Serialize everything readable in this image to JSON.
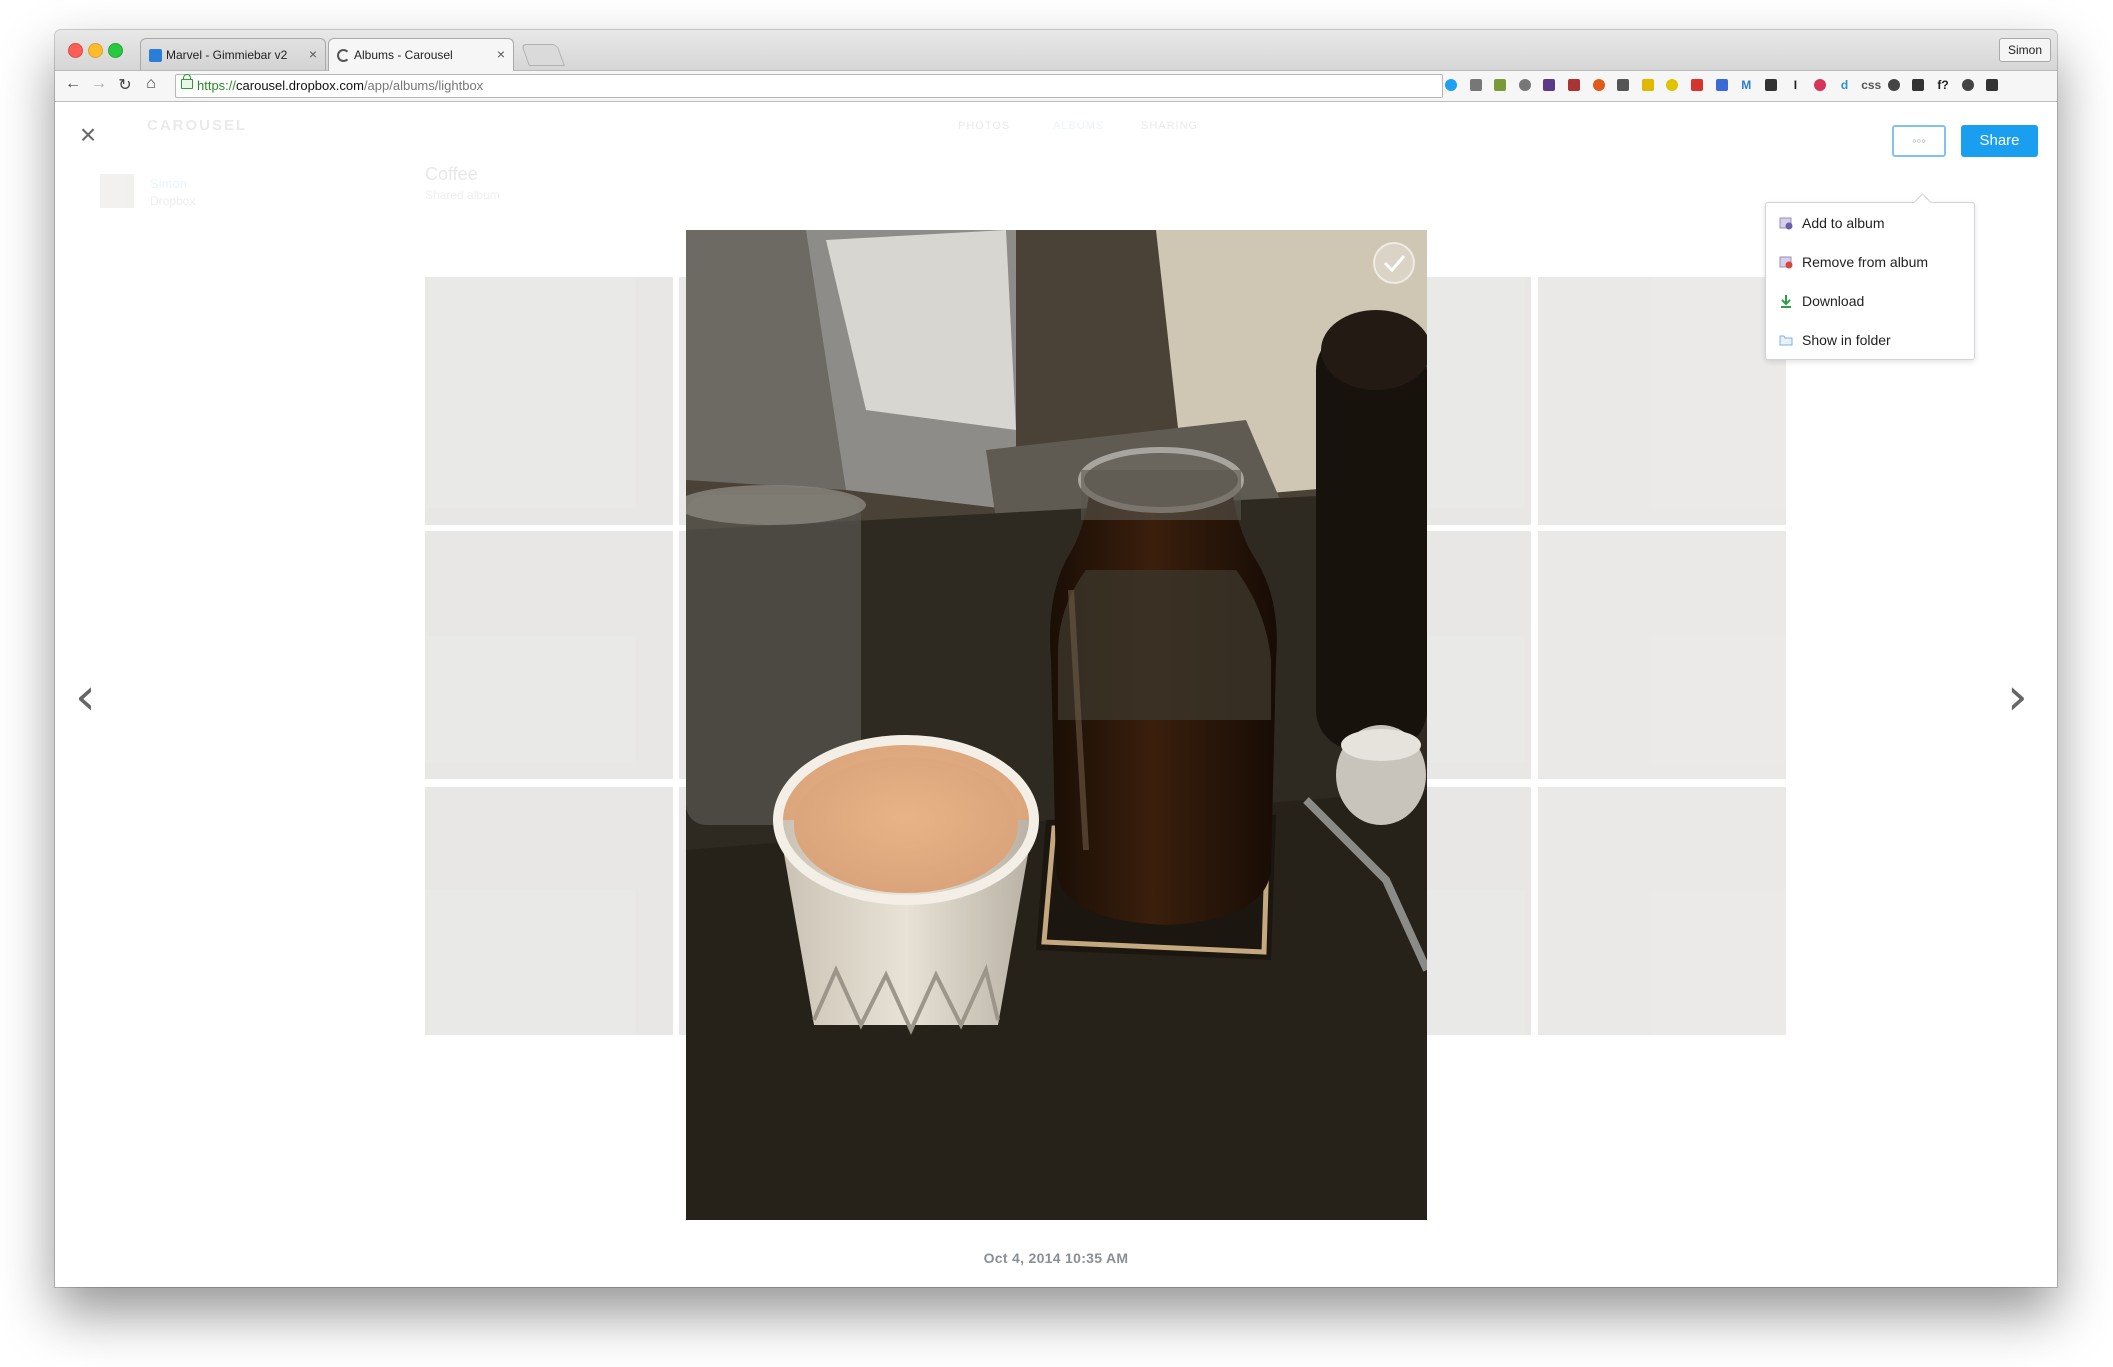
{
  "browser": {
    "tabs": [
      {
        "title": "Marvel - Gimmiebar v2",
        "close": "×"
      },
      {
        "title": "Albums - Carousel",
        "close": "×"
      }
    ],
    "profile": "Simon",
    "url": {
      "scheme": "https://",
      "host": "carousel.dropbox.com",
      "path": "/app/albums/lightbox"
    },
    "extensions": [
      "twitter-icon",
      "reader-icon",
      "feed-icon",
      "star-icon",
      "ext-1",
      "code-icon",
      "fire-icon",
      "mail-icon",
      "note-icon",
      "ext-2",
      "opera-icon",
      "color-icon",
      "m-icon",
      "bars-icon",
      "i-icon",
      "plus-icon",
      "d-icon",
      "css-icon",
      "clock-icon",
      "panel-icon",
      "font-icon",
      "ext-3",
      "menu-icon"
    ],
    "extension_glyphs": {
      "css-icon": "css",
      "font-icon": "f?",
      "i-icon": "I",
      "d-icon": "d",
      "m-icon": "M"
    }
  },
  "app": {
    "logo": "CAROUSEL",
    "nav": [
      "PHOTOS",
      "ALBUMS",
      "SHARING"
    ],
    "sidebar": {
      "name": "Simon",
      "sub": "Dropbox"
    },
    "album": {
      "title": "Coffee",
      "sub": "Shared album"
    }
  },
  "lightbox": {
    "close_glyph": "×",
    "prev_glyph": "‹",
    "next_glyph": "›",
    "more_label": "◦◦◦",
    "share_label": "Share",
    "caption": "Oct 4, 2014 10:35 AM",
    "menu": [
      {
        "label": "Add to album",
        "icon": "add-album-icon"
      },
      {
        "label": "Remove from album",
        "icon": "remove-album-icon"
      },
      {
        "label": "Download",
        "icon": "download-icon"
      },
      {
        "label": "Show in folder",
        "icon": "folder-icon"
      }
    ]
  },
  "colors": {
    "accent": "#1a9ff0",
    "caption": "#8a8f96"
  }
}
